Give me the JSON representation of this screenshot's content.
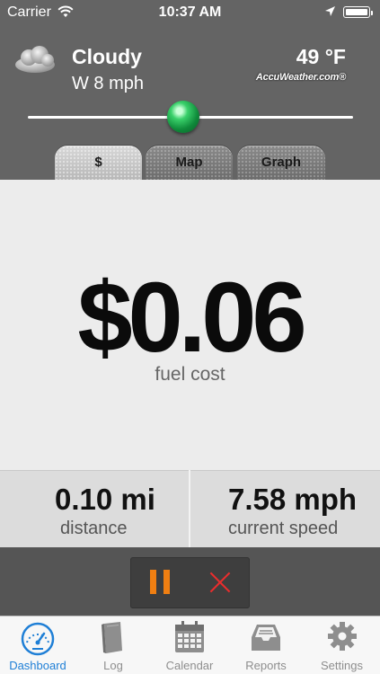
{
  "status_bar": {
    "carrier": "Carrier",
    "time": "10:37 AM"
  },
  "weather": {
    "condition": "Cloudy",
    "wind": "W 8 mph",
    "temperature": "49 °F",
    "provider": "AccuWeather.com®",
    "icon": "cloud-icon"
  },
  "slider": {
    "level_fraction": 0.5
  },
  "view_tabs": [
    {
      "label": "$",
      "active": true
    },
    {
      "label": "Map",
      "active": false
    },
    {
      "label": "Graph",
      "active": false
    }
  ],
  "cost": {
    "value": "$0.06",
    "label": "fuel cost"
  },
  "stats": {
    "distance": {
      "value": "0.10 mi",
      "label": "distance"
    },
    "speed": {
      "value": "7.58 mph",
      "label": "current speed"
    }
  },
  "controls": {
    "pause_icon": "pause-icon",
    "stop_icon": "close-icon",
    "pause_color": "#f07f12",
    "stop_color": "#ea2d2d"
  },
  "tab_bar": {
    "active_color": "#1f7fd6",
    "items": [
      {
        "label": "Dashboard",
        "icon": "speedometer-icon",
        "active": true
      },
      {
        "label": "Log",
        "icon": "book-icon",
        "active": false
      },
      {
        "label": "Calendar",
        "icon": "calendar-icon",
        "active": false
      },
      {
        "label": "Reports",
        "icon": "inbox-icon",
        "active": false
      },
      {
        "label": "Settings",
        "icon": "gear-icon",
        "active": false
      }
    ]
  }
}
